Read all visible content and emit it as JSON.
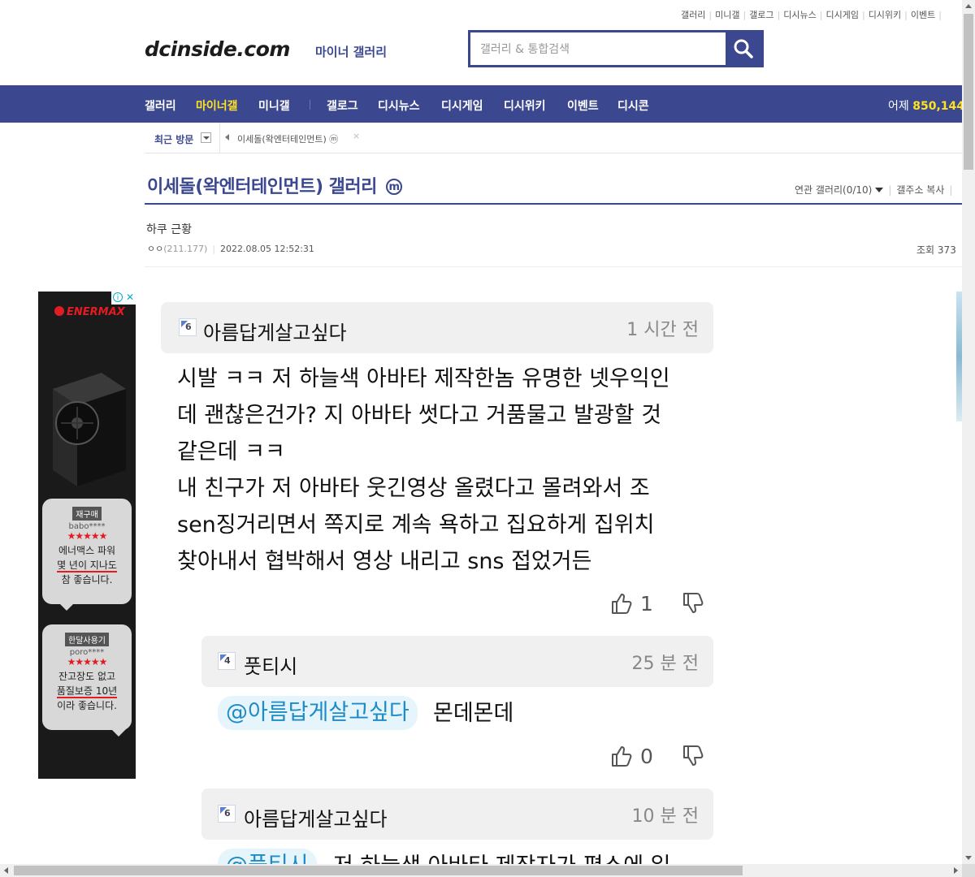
{
  "util_links": [
    "갤러리",
    "미니갤",
    "갤로그",
    "디시뉴스",
    "디시게임",
    "디시위키",
    "이벤트"
  ],
  "header": {
    "logo": "dcinside.com",
    "logo_sub": "마이너 갤러리",
    "search_placeholder": "갤러리 & 통합검색"
  },
  "nav": {
    "items": [
      "갤러리",
      "마이너갤",
      "미니갤",
      "갤로그",
      "디시뉴스",
      "디시게임",
      "디시위키",
      "이벤트",
      "디시콘"
    ],
    "active": "마이너갤",
    "visit_label": "어제",
    "visit_count": "850,144"
  },
  "recent": {
    "label": "최근 방문",
    "item": "이세돌(왁엔터테인먼트) ⓜ",
    "close": "×"
  },
  "gallery": {
    "title": "이세돌(왁엔터테인먼트) 갤러리",
    "mark": "m",
    "related": "연관 갤러리(0/10)",
    "copy_addr": "갤주소 복사"
  },
  "post": {
    "title": "하쿠 근황",
    "nick": "ㅇㅇ",
    "ip": "(211.177)",
    "date": "2022.08.05 12:52:31",
    "views_label": "조회",
    "views": "373"
  },
  "ad": {
    "brand": "ENERMAX",
    "reviews": [
      {
        "tag": "재구매",
        "user": "babo****",
        "stars": "★★★★★",
        "line1": "에너맥스 파워",
        "line2": "몇 년이 지나도",
        "line3": "참 좋습니다."
      },
      {
        "tag": "한달사용기",
        "user": "poro****",
        "stars": "★★★★★",
        "line1": "잔고장도 없고",
        "line2": "품질보증 10년",
        "line3": "이라 좋습니다."
      }
    ]
  },
  "comments": [
    {
      "level": "6",
      "name": "아름답게살고싶다",
      "time": "1 시간 전",
      "lines": [
        "시발 ㅋㅋ 저 하늘색 아바타 제작한놈 유명한 넷우익인",
        "데 괜찮은건가? 지 아바타 썻다고 거품물고 발광할 것",
        "같은데 ㅋㅋ",
        "내 친구가 저 아바타 웃긴영상 올렸다고 몰려와서 조",
        "sen징거리면서 쪽지로 계속 욕하고 집요하게 집위치",
        "찾아내서 협박해서 영상 내리고 sns 접었거든"
      ],
      "likes": "1"
    },
    {
      "level": "4",
      "name": "풋티시",
      "time": "25 분 전",
      "mention": "@아름답게살고싶다",
      "text": "몬데몬데",
      "likes": "0"
    },
    {
      "level": "6",
      "name": "아름답게살고싶다",
      "time": "10 분 전",
      "mention": "@풋티시",
      "text": "저 하늘색 아바타 제작자가 평소에 일"
    }
  ]
}
